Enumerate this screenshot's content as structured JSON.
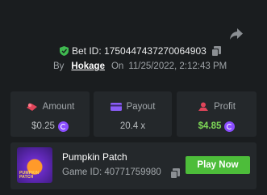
{
  "bet": {
    "label": "Bet ID: 1750447437270064903"
  },
  "meta": {
    "by": "By",
    "user": "Hokage",
    "on": "On",
    "date": "11/25/2022, 2:12:43 PM"
  },
  "stats": [
    {
      "label": "Amount",
      "value": "$0.25"
    },
    {
      "label": "Payout",
      "value": "20.4 x"
    },
    {
      "label": "Profit",
      "value": "$4.85"
    }
  ],
  "game": {
    "title": "Pumpkin Patch",
    "id_label": "Game ID: 40771759980",
    "thumb_text": "PUMPKIN PATCH",
    "play_label": "Play Now"
  },
  "colors": {
    "accent_green": "#4dbd3a",
    "profit_green": "#7ed957",
    "coin_purple": "#8a4dff",
    "shield_green": "#3fb950"
  }
}
